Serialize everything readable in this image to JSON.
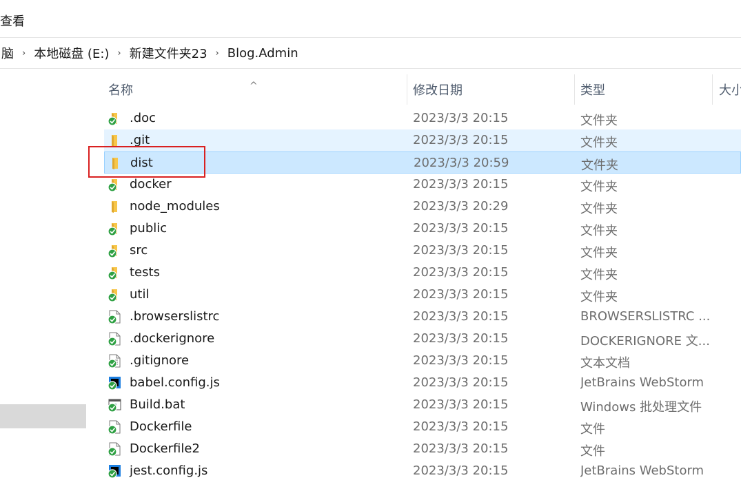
{
  "menu": {
    "view": "查看"
  },
  "breadcrumb": {
    "items": [
      "脑",
      "本地磁盘 (E:)",
      "新建文件夹23",
      "Blog.Admin"
    ],
    "separator": "›"
  },
  "columns": {
    "name": "名称",
    "modified": "修改日期",
    "type": "类型",
    "size": "大小"
  },
  "sort_indicator": "^",
  "files": [
    {
      "name": ".doc",
      "date": "2023/3/3 20:15",
      "type": "文件夹",
      "icon": "folder-synced-icon"
    },
    {
      "name": ".git",
      "date": "2023/3/3 20:15",
      "type": "文件夹",
      "icon": "folder-icon"
    },
    {
      "name": "dist",
      "date": "2023/3/3 20:59",
      "type": "文件夹",
      "icon": "folder-icon"
    },
    {
      "name": "docker",
      "date": "2023/3/3 20:15",
      "type": "文件夹",
      "icon": "folder-synced-icon"
    },
    {
      "name": "node_modules",
      "date": "2023/3/3 20:29",
      "type": "文件夹",
      "icon": "folder-icon"
    },
    {
      "name": "public",
      "date": "2023/3/3 20:15",
      "type": "文件夹",
      "icon": "folder-synced-icon"
    },
    {
      "name": "src",
      "date": "2023/3/3 20:15",
      "type": "文件夹",
      "icon": "folder-synced-icon"
    },
    {
      "name": "tests",
      "date": "2023/3/3 20:15",
      "type": "文件夹",
      "icon": "folder-synced-icon"
    },
    {
      "name": "util",
      "date": "2023/3/3 20:15",
      "type": "文件夹",
      "icon": "folder-synced-icon"
    },
    {
      "name": ".browserslistrc",
      "date": "2023/3/3 20:15",
      "type": "BROWSERSLISTRC ...",
      "icon": "file-synced-icon"
    },
    {
      "name": ".dockerignore",
      "date": "2023/3/3 20:15",
      "type": "DOCKERIGNORE 文...",
      "icon": "file-synced-icon"
    },
    {
      "name": ".gitignore",
      "date": "2023/3/3 20:15",
      "type": "文本文档",
      "icon": "text-file-synced-icon"
    },
    {
      "name": "babel.config.js",
      "date": "2023/3/3 20:15",
      "type": "JetBrains WebStorm",
      "icon": "webstorm-file-synced-icon"
    },
    {
      "name": "Build.bat",
      "date": "2023/3/3 20:15",
      "type": "Windows 批处理文件",
      "icon": "batch-file-synced-icon"
    },
    {
      "name": "Dockerfile",
      "date": "2023/3/3 20:15",
      "type": "文件",
      "icon": "file-synced-icon"
    },
    {
      "name": "Dockerfile2",
      "date": "2023/3/3 20:15",
      "type": "文件",
      "icon": "file-synced-icon"
    },
    {
      "name": "jest.config.js",
      "date": "2023/3/3 20:15",
      "type": "JetBrains WebStorm",
      "icon": "webstorm-file-synced-icon"
    }
  ],
  "colors": {
    "selected_row": "#cce8ff",
    "hover_row": "#e5f3ff",
    "highlight_box": "#d92020",
    "folder": "#f7c64a",
    "sync_badge": "#2ea043"
  }
}
